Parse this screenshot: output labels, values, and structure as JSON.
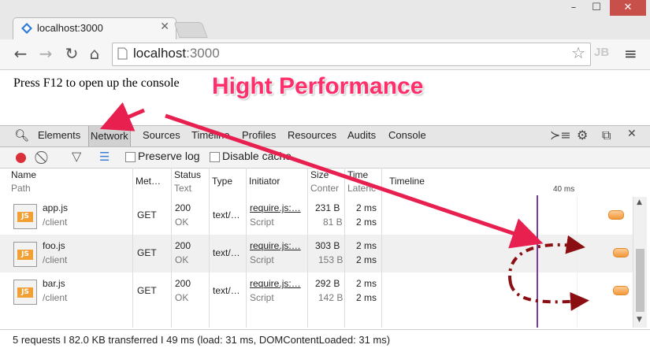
{
  "browser": {
    "tab_title": "localhost:3000",
    "url_host": "localhost",
    "url_port": ":3000",
    "window_controls": {
      "minimize": "–",
      "maximize": "☐",
      "close": "✕"
    },
    "extension_label": "JB"
  },
  "page": {
    "text": "Press F12 to open up the console",
    "annotation": "Hight Performance",
    "annotation_color": "#ff2f6c"
  },
  "devtools": {
    "tabs": [
      "Elements",
      "Network",
      "Sources",
      "Timeline",
      "Profiles",
      "Resources",
      "Audits",
      "Console"
    ],
    "active_tab": "Network",
    "filter_bar": {
      "preserve_log": "Preserve log",
      "disable_cache": "Disable cache"
    },
    "columns": [
      {
        "title": "Name",
        "subtitle": "Path"
      },
      {
        "title": "Met…",
        "subtitle": ""
      },
      {
        "title": "Status",
        "subtitle": "Text"
      },
      {
        "title": "Type",
        "subtitle": ""
      },
      {
        "title": "Initiator",
        "subtitle": ""
      },
      {
        "title": "Size",
        "subtitle": "Conter"
      },
      {
        "title": "Time",
        "subtitle": "Latenc"
      },
      {
        "title": "Timeline",
        "subtitle": ""
      }
    ],
    "timeline_marker": "40 ms",
    "requests": [
      {
        "name": "app.js",
        "path": "/client",
        "method": "GET",
        "status": "200",
        "status_text": "OK",
        "type": "text/…",
        "initiator": "require.js:…",
        "initiator_sub": "Script",
        "size": "231 B",
        "content": "81 B",
        "time": "2 ms",
        "latency": "2 ms",
        "bar_start_ms": 49,
        "bar_end_ms": 52
      },
      {
        "name": "foo.js",
        "path": "/client",
        "method": "GET",
        "status": "200",
        "status_text": "OK",
        "type": "text/…",
        "initiator": "require.js:…",
        "initiator_sub": "Script",
        "size": "303 B",
        "content": "153 B",
        "time": "2 ms",
        "latency": "2 ms",
        "bar_start_ms": 50,
        "bar_end_ms": 53
      },
      {
        "name": "bar.js",
        "path": "/client",
        "method": "GET",
        "status": "200",
        "status_text": "OK",
        "type": "text/…",
        "initiator": "require.js:…",
        "initiator_sub": "Script",
        "size": "292 B",
        "content": "142 B",
        "time": "2 ms",
        "latency": "2 ms",
        "bar_start_ms": 50,
        "bar_end_ms": 53
      }
    ],
    "status_bar": "5 requests I 82.0 KB transferred I 49 ms (load: 31 ms, DOMContentLoaded: 31 ms)"
  }
}
